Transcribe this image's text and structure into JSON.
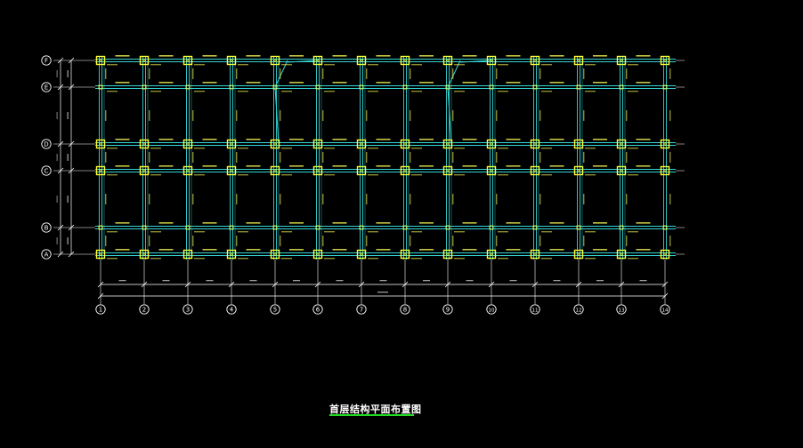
{
  "drawing": {
    "title": "首层结构平面布置图",
    "colors": {
      "background": "#000000",
      "beam": "#35d6d6",
      "column": "#ffff33",
      "label": "#e8e850",
      "dim": "#ffffff",
      "axis_bubble": "#ffffff",
      "title_underline": "#22dd22"
    },
    "axes_x": [
      {
        "label": "1"
      },
      {
        "label": "2"
      },
      {
        "label": "3"
      },
      {
        "label": "4"
      },
      {
        "label": "5"
      },
      {
        "label": "6"
      },
      {
        "label": "7"
      },
      {
        "label": "8"
      },
      {
        "label": "9"
      },
      {
        "label": "10"
      },
      {
        "label": "11"
      },
      {
        "label": "12"
      },
      {
        "label": "13"
      },
      {
        "label": "14"
      }
    ],
    "axes_y": [
      {
        "label": "F"
      },
      {
        "label": "E"
      },
      {
        "label": "D"
      },
      {
        "label": "C"
      },
      {
        "label": "B"
      },
      {
        "label": "A"
      }
    ]
  }
}
